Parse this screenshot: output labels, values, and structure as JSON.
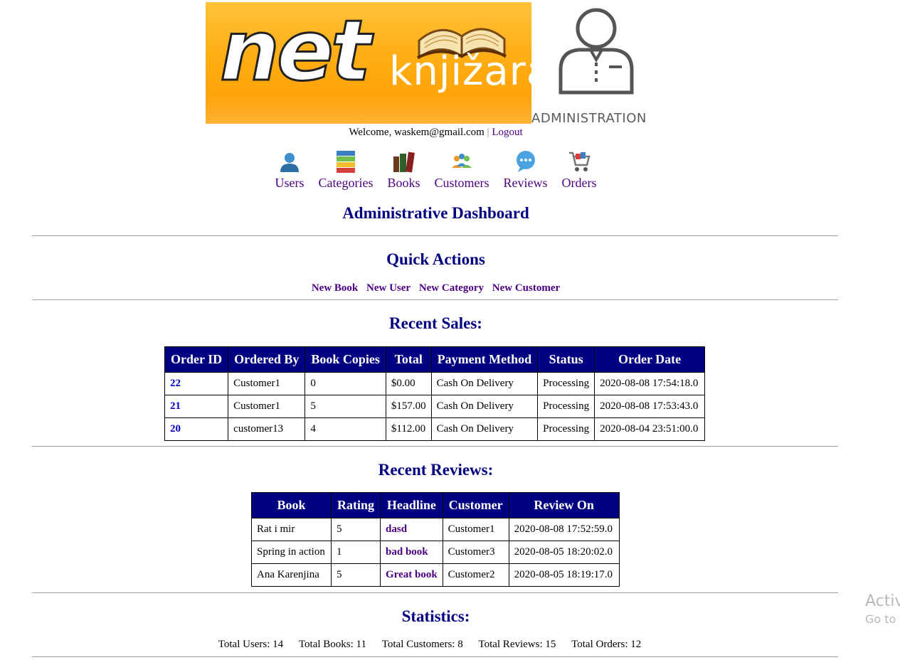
{
  "header": {
    "logo_net": "net",
    "logo_store": "knjižara",
    "admin_label": "ADMINISTRATION",
    "welcome_prefix": "Welcome,",
    "user_email": "waskem@gmail.com",
    "separator": "|",
    "logout_label": "Logout"
  },
  "menu": [
    {
      "label": "Users",
      "icon": "user-icon"
    },
    {
      "label": "Categories",
      "icon": "categories-icon"
    },
    {
      "label": "Books",
      "icon": "books-icon"
    },
    {
      "label": "Customers",
      "icon": "customers-icon"
    },
    {
      "label": "Reviews",
      "icon": "reviews-icon"
    },
    {
      "label": "Orders",
      "icon": "cart-icon"
    }
  ],
  "dashboard_title": "Administrative Dashboard",
  "quick_actions": {
    "title": "Quick Actions",
    "links": [
      "New Book",
      "New User",
      "New Category",
      "New Customer"
    ]
  },
  "recent_sales": {
    "title": "Recent Sales:",
    "columns": [
      "Order ID",
      "Ordered By",
      "Book Copies",
      "Total",
      "Payment Method",
      "Status",
      "Order Date"
    ],
    "rows": [
      [
        "22",
        "Customer1",
        "0",
        "$0.00",
        "Cash On Delivery",
        "Processing",
        "2020-08-08 17:54:18.0"
      ],
      [
        "21",
        "Customer1",
        "5",
        "$157.00",
        "Cash On Delivery",
        "Processing",
        "2020-08-08 17:53:43.0"
      ],
      [
        "20",
        "customer13",
        "4",
        "$112.00",
        "Cash On Delivery",
        "Processing",
        "2020-08-04 23:51:00.0"
      ]
    ]
  },
  "recent_reviews": {
    "title": "Recent Reviews:",
    "columns": [
      "Book",
      "Rating",
      "Headline",
      "Customer",
      "Review On"
    ],
    "rows": [
      [
        "Rat i mir",
        "5",
        "dasd",
        "Customer1",
        "2020-08-08 17:52:59.0"
      ],
      [
        "Spring in action",
        "1",
        "bad book",
        "Customer3",
        "2020-08-05 18:20:02.0"
      ],
      [
        "Ana Karenjina",
        "5",
        "Great book",
        "Customer2",
        "2020-08-05 18:19:17.0"
      ]
    ]
  },
  "statistics": {
    "title": "Statistics:",
    "items": [
      "Total Users: 14",
      "Total Books: 11",
      "Total Customers: 8",
      "Total Reviews: 15",
      "Total Orders: 12"
    ]
  },
  "watermark": {
    "line1": "Activ",
    "line2": "Go to"
  },
  "colors": {
    "heading": "#000080",
    "table_header": "#000080",
    "link": "#4b0082",
    "order_id": "#0000cc",
    "logo_orange": "#ffa500"
  }
}
